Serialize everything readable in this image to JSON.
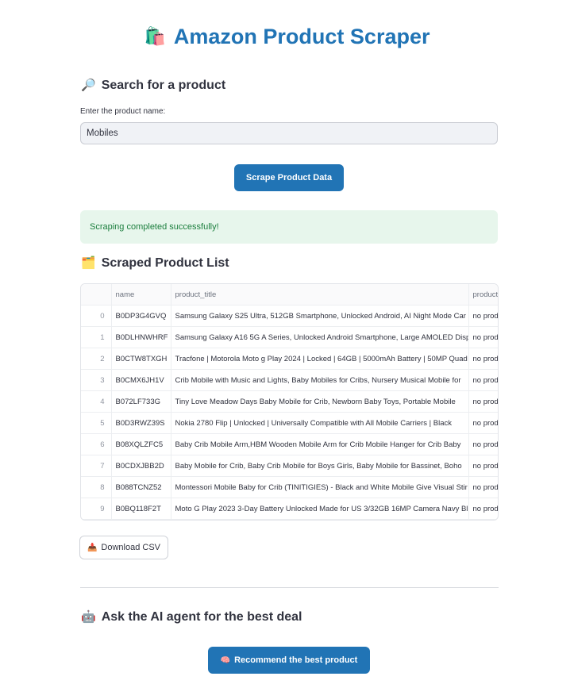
{
  "header": {
    "title": "Amazon Product Scraper",
    "icon": "shopping-bags-icon",
    "icon_glyph": "🛍️"
  },
  "search_section": {
    "heading": "Search for a product",
    "icon": "magnifier-icon",
    "icon_glyph": "🔎",
    "input_label": "Enter the product name:",
    "input_value": "Mobiles",
    "button_label": "Scrape Product Data"
  },
  "status": {
    "message": "Scraping completed successfully!",
    "color": "#1b7e3d"
  },
  "product_section": {
    "heading": "Scraped Product List",
    "icon": "folder-icon",
    "icon_glyph": "🗂️",
    "columns": [
      "",
      "name",
      "product_title",
      "product_"
    ],
    "rows": [
      {
        "index": "0",
        "name": "B0DP3G4GVQ",
        "title": "Samsung Galaxy S25 Ultra, 512GB Smartphone, Unlocked Android, AI Night Mode Car",
        "extra": "no prod"
      },
      {
        "index": "1",
        "name": "B0DLHNWHRF",
        "title": "Samsung Galaxy A16 5G A Series, Unlocked Android Smartphone, Large AMOLED Disp",
        "extra": "no prod"
      },
      {
        "index": "2",
        "name": "B0CTW8TXGH",
        "title": "Tracfone | Motorola Moto g Play 2024 | Locked | 64GB | 5000mAh Battery | 50MP Quad",
        "extra": "no prod"
      },
      {
        "index": "3",
        "name": "B0CMX6JH1V",
        "title": "Crib Mobile with Music and Lights, Baby Mobiles for Cribs, Nursery Musical Mobile for",
        "extra": "no prod"
      },
      {
        "index": "4",
        "name": "B072LF733G",
        "title": "Tiny Love Meadow Days Baby Mobile for Crib, Newborn Baby Toys, Portable Mobile",
        "extra": "no prod"
      },
      {
        "index": "5",
        "name": "B0D3RWZ39S",
        "title": "Nokia 2780 Flip | Unlocked | Universally Compatible with All Mobile Carriers | Black",
        "extra": "no prod"
      },
      {
        "index": "6",
        "name": "B08XQLZFC5",
        "title": "Baby Crib Mobile Arm,HBM Wooden Mobile Arm for Crib Mobile Hanger for Crib Baby",
        "extra": "no prod"
      },
      {
        "index": "7",
        "name": "B0CDXJBB2D",
        "title": "Baby Mobile for Crib, Baby Crib Mobile for Boys Girls, Baby Mobile for Bassinet, Boho",
        "extra": "no prod"
      },
      {
        "index": "8",
        "name": "B088TCNZ52",
        "title": "Montessori Mobile Baby for Crib (TINITIGIES) - Black and White Mobile Give Visual Stir",
        "extra": "no prod"
      },
      {
        "index": "9",
        "name": "B0BQ118F2T",
        "title": "Moto G Play 2023 3-Day Battery Unlocked Made for US 3/32GB 16MP Camera Navy Blu",
        "extra": "no prod"
      }
    ],
    "download_label": "Download CSV",
    "download_icon": "inbox-tray-icon",
    "download_glyph": "📥"
  },
  "ai_section": {
    "heading": "Ask the AI agent for the best deal",
    "icon": "robot-icon",
    "icon_glyph": "🤖",
    "button_label": "Recommend the best product",
    "button_icon": "brain-icon",
    "button_glyph": "🧠"
  },
  "colors": {
    "accent": "#2174b5",
    "success_bg": "#e7f6ec"
  }
}
